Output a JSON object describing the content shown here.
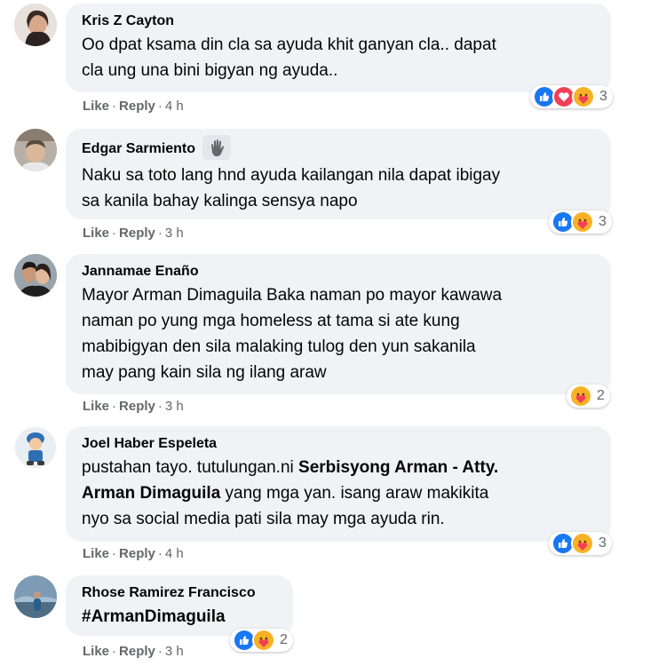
{
  "comments": [
    {
      "author": "Kris Z Cayton",
      "text_lines": [
        "Oo dpat ksama din cla sa ayuda khit ganyan cla.. dapat",
        "cla ung una bini bigyan ng ayuda.."
      ],
      "actions": {
        "like": "Like",
        "reply": "Reply",
        "time": "4 h"
      },
      "reactions": {
        "icons": [
          "like-icon",
          "love-icon",
          "care-icon"
        ],
        "count": "3"
      }
    },
    {
      "author": "Edgar Sarmiento",
      "author_icon": "wave-icon",
      "text_lines": [
        "Naku sa toto lang hnd ayuda kailangan nila dapat ibigay",
        "sa kanila bahay kalinga sensya napo"
      ],
      "actions": {
        "like": "Like",
        "reply": "Reply",
        "time": "3 h"
      },
      "reactions": {
        "icons": [
          "like-icon",
          "care-icon"
        ],
        "count": "3"
      }
    },
    {
      "author": "Jannamae Enaño",
      "text_lines": [
        "Mayor Arman Dimaguila Baka naman po mayor kawawa",
        "naman po yung mga homeless at tama si ate kung",
        "mabibigyan den sila malaking tulog den yun sakanila",
        "may pang kain sila ng ilang araw"
      ],
      "actions": {
        "like": "Like",
        "reply": "Reply",
        "time": "3 h"
      },
      "reactions": {
        "icons": [
          "care-icon"
        ],
        "count": "2"
      }
    },
    {
      "author": "Joel Haber Espeleta",
      "text_line1": "pustahan tayo. tutulungan.ni ",
      "text_bold1": "Serbisyong Arman - Atty.",
      "text_bold2": "Arman Dimaguila",
      "text_line2_rest": " yang mga yan. isang araw makikita",
      "text_line3": "nyo sa social media pati sila may mga ayuda rin.",
      "actions": {
        "like": "Like",
        "reply": "Reply",
        "time": "4 h"
      },
      "reactions": {
        "icons": [
          "like-icon",
          "care-icon"
        ],
        "count": "3"
      }
    },
    {
      "author": "Rhose Ramirez Francisco",
      "text_lines": [
        "#ArmanDimaguila"
      ],
      "actions": {
        "like": "Like",
        "reply": "Reply",
        "time": "3 h"
      },
      "reactions": {
        "icons": [
          "like-icon",
          "care-icon"
        ],
        "count": "2"
      }
    }
  ],
  "colors": {
    "bubble": "#f0f2f5",
    "meta": "#65676b",
    "like": "#1877f2",
    "love": "#f33e58",
    "care": "#f7b125"
  }
}
